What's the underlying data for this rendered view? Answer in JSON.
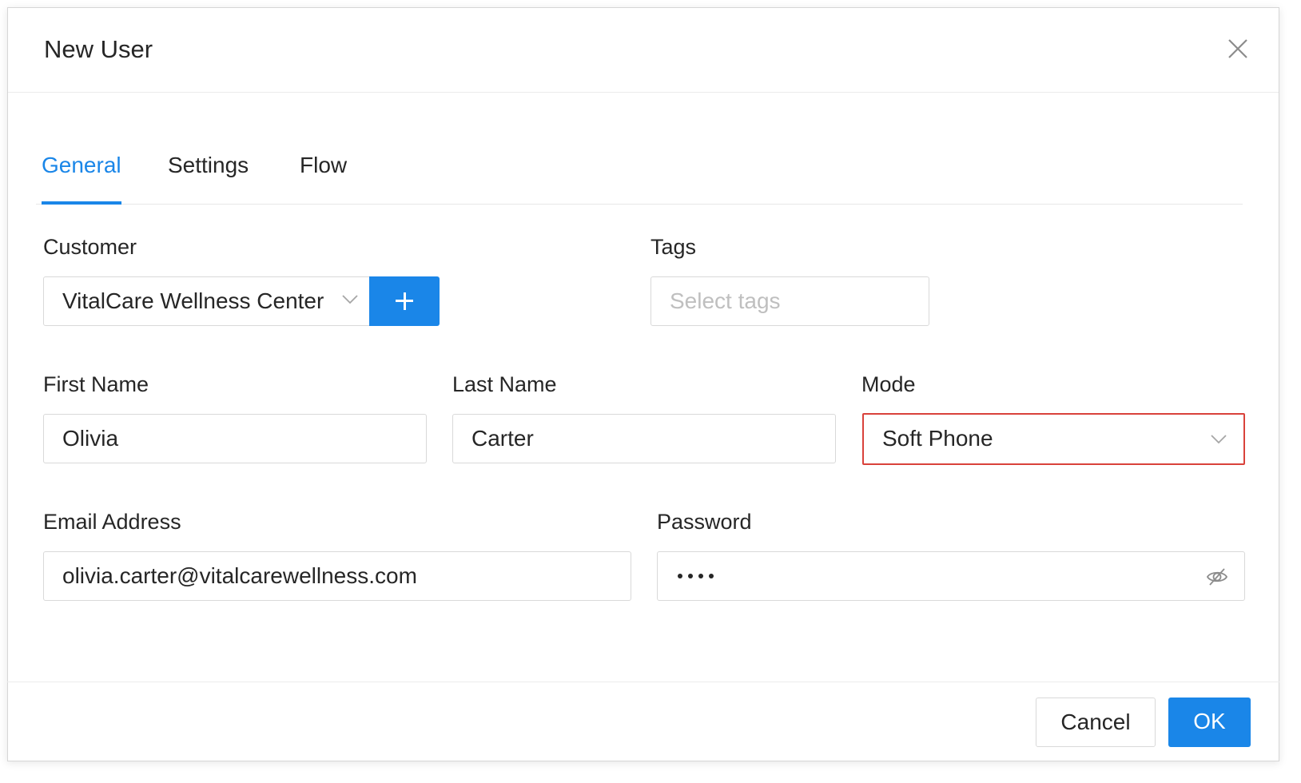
{
  "dialog": {
    "title": "New User"
  },
  "tabs": [
    {
      "label": "General",
      "active": true
    },
    {
      "label": "Settings",
      "active": false
    },
    {
      "label": "Flow",
      "active": false
    }
  ],
  "form": {
    "customer": {
      "label": "Customer",
      "value": "VitalCare Wellness Center"
    },
    "tags": {
      "label": "Tags",
      "placeholder": "Select tags"
    },
    "first_name": {
      "label": "First Name",
      "value": "Olivia"
    },
    "last_name": {
      "label": "Last Name",
      "value": "Carter"
    },
    "mode": {
      "label": "Mode",
      "value": "Soft Phone"
    },
    "email": {
      "label": "Email Address",
      "value": "olivia.carter@vitalcarewellness.com"
    },
    "password": {
      "label": "Password",
      "masked_length": 4
    }
  },
  "footer": {
    "cancel_label": "Cancel",
    "ok_label": "OK"
  },
  "colors": {
    "accent": "#1a86e8",
    "highlight_border": "#d9423b"
  },
  "icons": {
    "close": "close-icon",
    "dropdown": "chevron-down-icon",
    "add": "plus-icon",
    "password_toggle": "eye-slash-icon"
  }
}
